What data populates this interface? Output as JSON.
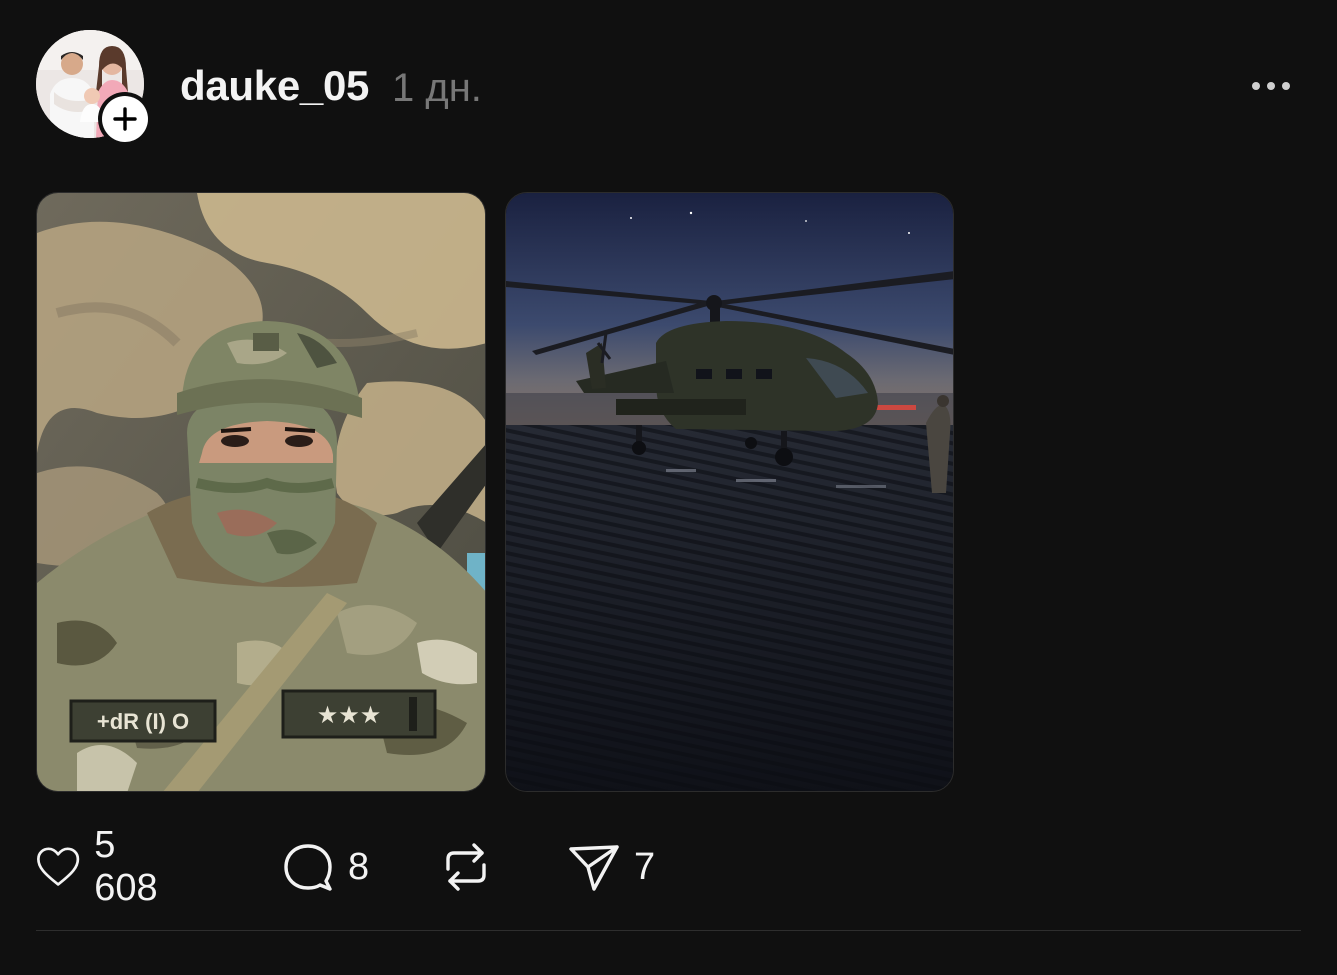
{
  "post": {
    "username": "dauke_05",
    "time": "1 дн.",
    "avatar_icon": "family-photo-avatar",
    "media": [
      {
        "description_icon": "soldier-selfie-photo"
      },
      {
        "description_icon": "helicopter-photo"
      }
    ],
    "actions": {
      "likes": "5 608",
      "comments": "8",
      "reposts": "",
      "shares": "7"
    }
  },
  "colors": {
    "background": "#101010",
    "text": "#f3f3f3",
    "muted": "#777777",
    "divider": "#2e2e2e"
  }
}
